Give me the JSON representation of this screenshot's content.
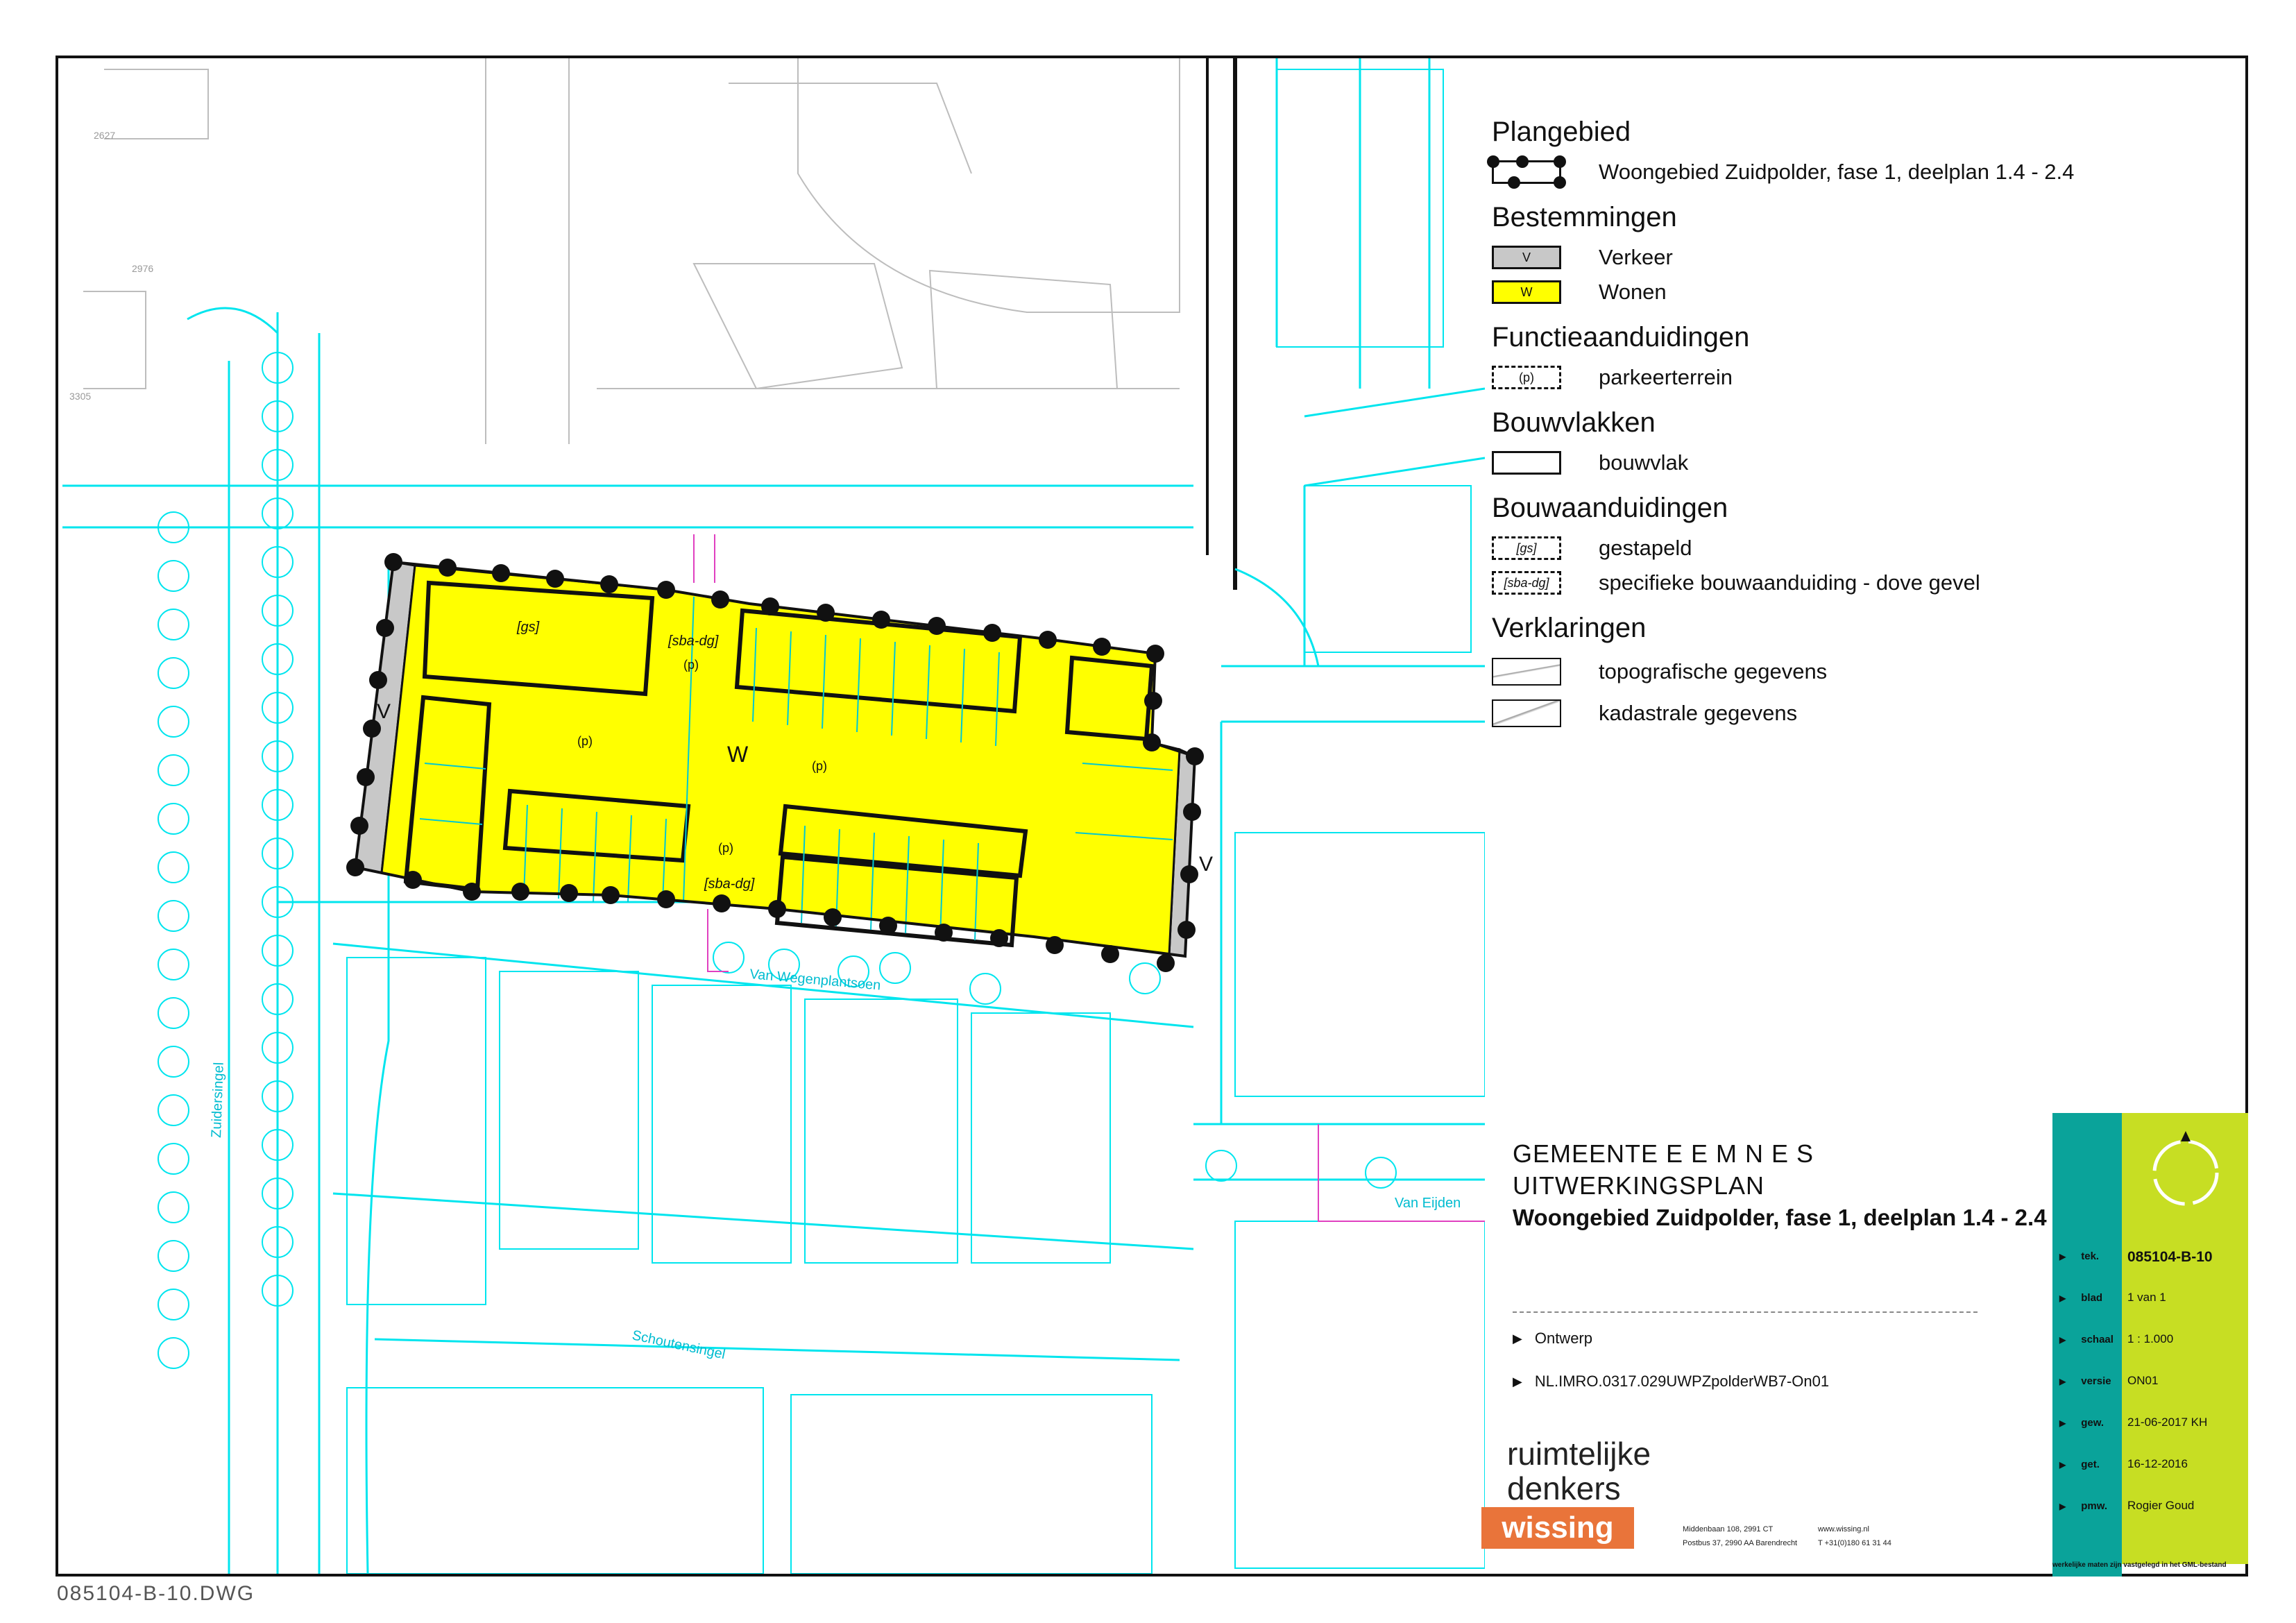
{
  "footer_filename": "085104-B-10.DWG",
  "colors": {
    "topography": "#00e5ee",
    "woonbestemming": "#ffff00",
    "verkeer": "#c8c8c8",
    "plangrens": "#111111",
    "titleblock_teal": "#0aa39a",
    "titleblock_lime": "#c7de23",
    "wissing_orange": "#e9743a"
  },
  "legend": {
    "sections": [
      {
        "heading": "Plangebied",
        "items": [
          {
            "symbol": "",
            "label": "Woongebied Zuidpolder, fase 1, deelplan 1.4 - 2.4"
          }
        ]
      },
      {
        "heading": "Bestemmingen",
        "items": [
          {
            "symbol": "V",
            "label": "Verkeer"
          },
          {
            "symbol": "W",
            "label": "Wonen"
          }
        ]
      },
      {
        "heading": "Functieaanduidingen",
        "items": [
          {
            "symbol": "(p)",
            "label": "parkeerterrein"
          }
        ]
      },
      {
        "heading": "Bouwvlakken",
        "items": [
          {
            "symbol": "",
            "label": "bouwvlak"
          }
        ]
      },
      {
        "heading": "Bouwaanduidingen",
        "items": [
          {
            "symbol": "[gs]",
            "label": "gestapeld"
          },
          {
            "symbol": "[sba-dg]",
            "label": "specifieke bouwaanduiding - dove gevel"
          }
        ]
      },
      {
        "heading": "Verklaringen",
        "items": [
          {
            "symbol": "",
            "label": "topografische gegevens"
          },
          {
            "symbol": "",
            "label": "kadastrale gegevens"
          }
        ]
      }
    ]
  },
  "map_labels": {
    "wonen": "W",
    "verkeer_west": "V",
    "verkeer_east": "V",
    "gs": "[gs]",
    "sba1": "[sba-dg]",
    "sba2": "[sba-dg]",
    "p1": "(p)",
    "p2": "(p)",
    "p3": "(p)",
    "p4": "(p)",
    "street_south": "Van Wegenplantsoen",
    "street_schout": "Schoutensingel",
    "street_zuider": "Zuidersingel",
    "street_eijden": "Van Eijden",
    "parcel1": "2976",
    "parcel2": "3305",
    "parcel3": "2627"
  },
  "municipality": {
    "line1": "GEMEENTE  E E M N E S",
    "line2": "UITWERKINGSPLAN",
    "line3": "Woongebied Zuidpolder, fase 1, deelplan 1.4 - 2.4"
  },
  "status": {
    "phase": "Ontwerp",
    "imro_id": "NL.IMRO.0317.029UWPZpolderWB7-On01"
  },
  "titleblock": {
    "rows": [
      {
        "key": "tek.",
        "value": "085104-B-10"
      },
      {
        "key": "blad",
        "value": "1 van 1"
      },
      {
        "key": "schaal",
        "value": "1 : 1.000"
      },
      {
        "key": "versie",
        "value": "ON01"
      },
      {
        "key": "gew.",
        "value": "21-06-2017 KH"
      },
      {
        "key": "get.",
        "value": "16-12-2016"
      },
      {
        "key": "pmw.",
        "value": "Rogier Goud"
      }
    ],
    "note": "werkelijke maten zijn vastgelegd in het GML-bestand"
  },
  "company": {
    "logo_line1": "ruimtelijke",
    "logo_line2": "denkers",
    "brand": "wissing",
    "address1": "Middenbaan 108, 2991 CT",
    "address2": "Postbus 37, 2990 AA Barendrecht",
    "web": "www.wissing.nl",
    "phone": "T +31(0)180 61 31 44"
  }
}
